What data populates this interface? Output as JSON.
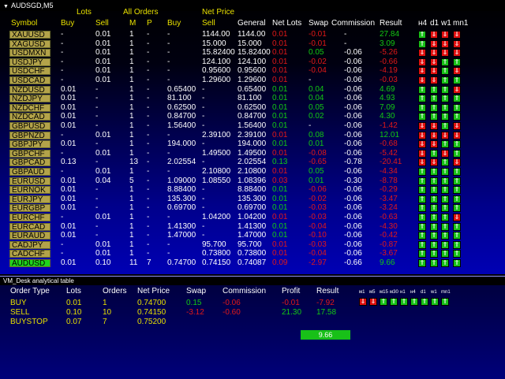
{
  "window": {
    "title": "AUDSGD,M5"
  },
  "table": {
    "header_groups": {
      "lots": "Lots",
      "all_orders": "All Orders",
      "net_price": "Net Price"
    },
    "columns": {
      "symbol": "Symbol",
      "buy": "Buy",
      "sell": "Sell",
      "m": "M",
      "p": "P",
      "np_buy": "Buy",
      "np_sell": "Sell",
      "general": "General",
      "net_lots": "Net Lots",
      "swap": "Swap",
      "commission": "Commission",
      "result": "Result",
      "h4": "н4",
      "d1": "d1",
      "w1": "w1",
      "mn1": "mn1"
    },
    "rows": [
      {
        "symbol": "XAUUSD",
        "buy": "-",
        "sell": "0.01",
        "m": "1",
        "p": "-",
        "np_buy": "-",
        "np_sell": "1144.00",
        "general": "1144.00",
        "net_lots": "0.01",
        "net_lots_color": "red",
        "swap": "-0.01",
        "swap_color": "red",
        "commission": "-",
        "result": "27.84",
        "result_color": "green",
        "tf": [
          "up",
          "dn",
          "dn",
          "dn"
        ]
      },
      {
        "symbol": "XAGUSD",
        "buy": "-",
        "sell": "0.01",
        "m": "1",
        "p": "-",
        "np_buy": "-",
        "np_sell": "15.000",
        "general": "15.000",
        "net_lots": "0.01",
        "net_lots_color": "red",
        "swap": "-0.01",
        "swap_color": "red",
        "commission": "-",
        "result": "3.09",
        "result_color": "green",
        "tf": [
          "up",
          "dn",
          "dn",
          "dn"
        ]
      },
      {
        "symbol": "USDMXN",
        "buy": "-",
        "sell": "0.01",
        "m": "1",
        "p": "-",
        "np_buy": "-",
        "np_sell": "15.82400",
        "general": "15.82400",
        "net_lots": "0.01",
        "net_lots_color": "red",
        "swap": "0.05",
        "swap_color": "green",
        "commission": "-0.06",
        "result": "-5.26",
        "result_color": "red",
        "tf": [
          "dn",
          "dn",
          "dn",
          "dn"
        ]
      },
      {
        "symbol": "USDJPY",
        "buy": "-",
        "sell": "0.01",
        "m": "1",
        "p": "-",
        "np_buy": "-",
        "np_sell": "124.100",
        "general": "124.100",
        "net_lots": "0.01",
        "net_lots_color": "red",
        "swap": "-0.02",
        "swap_color": "red",
        "commission": "-0.06",
        "result": "-0.66",
        "result_color": "red",
        "tf": [
          "dn",
          "dn",
          "up",
          "up"
        ]
      },
      {
        "symbol": "USDCHF",
        "buy": "-",
        "sell": "0.01",
        "m": "1",
        "p": "-",
        "np_buy": "-",
        "np_sell": "0.95600",
        "general": "0.95600",
        "net_lots": "0.01",
        "net_lots_color": "red",
        "swap": "-0.04",
        "swap_color": "red",
        "commission": "-0.06",
        "result": "-4.19",
        "result_color": "red",
        "tf": [
          "dn",
          "dn",
          "up",
          "dn"
        ]
      },
      {
        "symbol": "USDCAD",
        "buy": "-",
        "sell": "0.01",
        "m": "1",
        "p": "-",
        "np_buy": "-",
        "np_sell": "1.29600",
        "general": "1.29600",
        "net_lots": "0.01",
        "net_lots_color": "red",
        "swap": "-",
        "swap_color": "white",
        "commission": "-0.06",
        "result": "-0.03",
        "result_color": "red",
        "tf": [
          "dn",
          "dn",
          "up",
          "up"
        ]
      },
      {
        "symbol": "NZDUSD",
        "buy": "0.01",
        "sell": "-",
        "m": "1",
        "p": "-",
        "np_buy": "0.65400",
        "np_sell": "-",
        "general": "0.65400",
        "net_lots": "0.01",
        "net_lots_color": "green",
        "swap": "0.04",
        "swap_color": "green",
        "commission": "-0.06",
        "result": "4.69",
        "result_color": "green",
        "tf": [
          "up",
          "up",
          "up",
          "dn"
        ]
      },
      {
        "symbol": "NZDJPY",
        "buy": "0.01",
        "sell": "-",
        "m": "1",
        "p": "-",
        "np_buy": "81.100",
        "np_sell": "-",
        "general": "81.100",
        "net_lots": "0.01",
        "net_lots_color": "green",
        "swap": "0.04",
        "swap_color": "green",
        "commission": "-0.06",
        "result": "4.93",
        "result_color": "green",
        "tf": [
          "up",
          "up",
          "up",
          "up"
        ]
      },
      {
        "symbol": "NZDCHF",
        "buy": "0.01",
        "sell": "-",
        "m": "1",
        "p": "-",
        "np_buy": "0.62500",
        "np_sell": "-",
        "general": "0.62500",
        "net_lots": "0.01",
        "net_lots_color": "green",
        "swap": "0.05",
        "swap_color": "green",
        "commission": "-0.06",
        "result": "7.09",
        "result_color": "green",
        "tf": [
          "up",
          "up",
          "up",
          "up"
        ]
      },
      {
        "symbol": "NZDCAD",
        "buy": "0.01",
        "sell": "-",
        "m": "1",
        "p": "-",
        "np_buy": "0.84700",
        "np_sell": "-",
        "general": "0.84700",
        "net_lots": "0.01",
        "net_lots_color": "green",
        "swap": "0.02",
        "swap_color": "green",
        "commission": "-0.06",
        "result": "4.30",
        "result_color": "green",
        "tf": [
          "up",
          "up",
          "up",
          "up"
        ]
      },
      {
        "symbol": "GBPUSD",
        "buy": "0.01",
        "sell": "-",
        "m": "1",
        "p": "-",
        "np_buy": "1.56400",
        "np_sell": "-",
        "general": "1.56400",
        "net_lots": "0.01",
        "net_lots_color": "green",
        "swap": "-",
        "swap_color": "white",
        "commission": "-0.06",
        "result": "-1.42",
        "result_color": "red",
        "tf": [
          "dn",
          "dn",
          "up",
          "dn"
        ]
      },
      {
        "symbol": "GBPNZD",
        "buy": "-",
        "sell": "0.01",
        "m": "1",
        "p": "-",
        "np_buy": "-",
        "np_sell": "2.39100",
        "general": "2.39100",
        "net_lots": "0.01",
        "net_lots_color": "red",
        "swap": "0.08",
        "swap_color": "green",
        "commission": "-0.06",
        "result": "12.01",
        "result_color": "green",
        "tf": [
          "dn",
          "dn",
          "dn",
          "dn"
        ]
      },
      {
        "symbol": "GBPJPY",
        "buy": "0.01",
        "sell": "-",
        "m": "1",
        "p": "-",
        "np_buy": "194.000",
        "np_sell": "-",
        "general": "194.000",
        "net_lots": "0.01",
        "net_lots_color": "green",
        "swap": "0.01",
        "swap_color": "green",
        "commission": "-0.06",
        "result": "-0.68",
        "result_color": "red",
        "tf": [
          "dn",
          "dn",
          "up",
          "up"
        ]
      },
      {
        "symbol": "GBPCHF",
        "buy": "-",
        "sell": "0.01",
        "m": "1",
        "p": "-",
        "np_buy": "-",
        "np_sell": "1.49500",
        "general": "1.49500",
        "net_lots": "0.01",
        "net_lots_color": "red",
        "swap": "-0.08",
        "swap_color": "red",
        "commission": "-0.06",
        "result": "-5.42",
        "result_color": "red",
        "tf": [
          "dn",
          "up",
          "dn",
          "up"
        ]
      },
      {
        "symbol": "GBPCAD",
        "buy": "0.13",
        "sell": "-",
        "m": "13",
        "p": "-",
        "np_buy": "2.02554",
        "np_sell": "-",
        "general": "2.02554",
        "net_lots": "0.13",
        "net_lots_color": "green",
        "swap": "-0.65",
        "swap_color": "red",
        "commission": "-0.78",
        "result": "-20.41",
        "result_color": "red",
        "tf": [
          "dn",
          "dn",
          "up",
          "dn"
        ]
      },
      {
        "symbol": "GBPAUD",
        "buy": "-",
        "sell": "0.01",
        "m": "1",
        "p": "-",
        "np_buy": "-",
        "np_sell": "2.10800",
        "general": "2.10800",
        "net_lots": "0.01",
        "net_lots_color": "red",
        "swap": "0.05",
        "swap_color": "green",
        "commission": "-0.06",
        "result": "-4.34",
        "result_color": "red",
        "tf": [
          "up",
          "up",
          "up",
          "up"
        ]
      },
      {
        "symbol": "EURUSD",
        "buy": "0.01",
        "sell": "0.04",
        "m": "5",
        "p": "-",
        "np_buy": "1.09000",
        "np_sell": "1.08550",
        "general": "1.08396",
        "net_lots": "0.03",
        "net_lots_color": "red",
        "swap": "0.01",
        "swap_color": "green",
        "commission": "-0.30",
        "result": "-8.78",
        "result_color": "red",
        "tf": [
          "up",
          "up",
          "up",
          "up"
        ]
      },
      {
        "symbol": "EURNOK",
        "buy": "0.01",
        "sell": "-",
        "m": "1",
        "p": "-",
        "np_buy": "8.88400",
        "np_sell": "-",
        "general": "8.88400",
        "net_lots": "0.01",
        "net_lots_color": "green",
        "swap": "-0.06",
        "swap_color": "red",
        "commission": "-0.06",
        "result": "-0.29",
        "result_color": "red",
        "tf": [
          "up",
          "up",
          "up",
          "up"
        ]
      },
      {
        "symbol": "EURJPY",
        "buy": "0.01",
        "sell": "-",
        "m": "1",
        "p": "-",
        "np_buy": "135.300",
        "np_sell": "-",
        "general": "135.300",
        "net_lots": "0.01",
        "net_lots_color": "green",
        "swap": "-0.02",
        "swap_color": "red",
        "commission": "-0.06",
        "result": "-3.47",
        "result_color": "red",
        "tf": [
          "up",
          "up",
          "up",
          "up"
        ]
      },
      {
        "symbol": "EURGBP",
        "buy": "0.01",
        "sell": "-",
        "m": "1",
        "p": "-",
        "np_buy": "0.69700",
        "np_sell": "-",
        "general": "0.69700",
        "net_lots": "0.01",
        "net_lots_color": "green",
        "swap": "-0.03",
        "swap_color": "red",
        "commission": "-0.06",
        "result": "-3.24",
        "result_color": "red",
        "tf": [
          "up",
          "up",
          "up",
          "up"
        ]
      },
      {
        "symbol": "EURCHF",
        "buy": "-",
        "sell": "0.01",
        "m": "1",
        "p": "-",
        "np_buy": "-",
        "np_sell": "1.04200",
        "general": "1.04200",
        "net_lots": "0.01",
        "net_lots_color": "red",
        "swap": "-0.03",
        "swap_color": "red",
        "commission": "-0.06",
        "result": "-0.63",
        "result_color": "red",
        "tf": [
          "up",
          "up",
          "up",
          "dn"
        ]
      },
      {
        "symbol": "EURCAD",
        "buy": "0.01",
        "sell": "-",
        "m": "1",
        "p": "-",
        "np_buy": "1.41300",
        "np_sell": "-",
        "general": "1.41300",
        "net_lots": "0.01",
        "net_lots_color": "green",
        "swap": "-0.04",
        "swap_color": "red",
        "commission": "-0.06",
        "result": "-4.30",
        "result_color": "red",
        "tf": [
          "up",
          "up",
          "up",
          "up"
        ]
      },
      {
        "symbol": "EURAUD",
        "buy": "0.01",
        "sell": "-",
        "m": "1",
        "p": "-",
        "np_buy": "1.47000",
        "np_sell": "-",
        "general": "1.47000",
        "net_lots": "0.01",
        "net_lots_color": "green",
        "swap": "-0.10",
        "swap_color": "red",
        "commission": "-0.06",
        "result": "-0.42",
        "result_color": "red",
        "tf": [
          "up",
          "up",
          "up",
          "up"
        ]
      },
      {
        "symbol": "CADJPY",
        "buy": "-",
        "sell": "0.01",
        "m": "1",
        "p": "-",
        "np_buy": "-",
        "np_sell": "95.700",
        "general": "95.700",
        "net_lots": "0.01",
        "net_lots_color": "red",
        "swap": "-0.03",
        "swap_color": "red",
        "commission": "-0.06",
        "result": "-0.87",
        "result_color": "red",
        "tf": [
          "up",
          "up",
          "up",
          "up"
        ]
      },
      {
        "symbol": "CADCHF",
        "buy": "-",
        "sell": "0.01",
        "m": "1",
        "p": "-",
        "np_buy": "-",
        "np_sell": "0.73800",
        "general": "0.73800",
        "net_lots": "0.01",
        "net_lots_color": "red",
        "swap": "-0.04",
        "swap_color": "red",
        "commission": "-0.06",
        "result": "-3.67",
        "result_color": "red",
        "tf": [
          "up",
          "up",
          "up",
          "up"
        ]
      },
      {
        "symbol": "AUDUSD",
        "buy": "0.01",
        "sell": "0.10",
        "m": "11",
        "p": "7",
        "np_buy": "0.74700",
        "np_sell": "0.74150",
        "general": "0.74087",
        "net_lots": "0.09",
        "net_lots_color": "red",
        "swap": "-2.97",
        "swap_color": "red",
        "commission": "-0.66",
        "result": "9.66",
        "result_color": "green",
        "tf": [
          "up",
          "up",
          "up",
          "up"
        ],
        "selected": true
      }
    ]
  },
  "panel": {
    "title": "VM_Desk analytical table",
    "headers": {
      "order_type": "Order Type",
      "lots": "Lots",
      "orders": "Orders",
      "net_price": "Net Price",
      "swap": "Swap",
      "commission": "Commission",
      "profit": "Profit",
      "result": "Result"
    },
    "rows": [
      {
        "order_type": "BUY",
        "lots": "0.01",
        "orders": "1",
        "net_price": "0.74700",
        "swap": "0.15",
        "swap_color": "green",
        "commission": "-0.06",
        "commission_color": "red",
        "profit": "-0.01",
        "profit_color": "red",
        "result": "-7.92",
        "result_color": "red"
      },
      {
        "order_type": "SELL",
        "lots": "0.10",
        "orders": "10",
        "net_price": "0.74150",
        "swap": "-3.12",
        "swap_color": "red",
        "commission": "-0.60",
        "commission_color": "red",
        "profit": "21.30",
        "profit_color": "green",
        "result": "17.58",
        "result_color": "green"
      },
      {
        "order_type": "BUYSTOP",
        "lots": "0.07",
        "orders": "7",
        "net_price": "0.75200",
        "swap": "",
        "commission": "",
        "profit": "",
        "result": ""
      }
    ],
    "tf_labels": [
      "м1",
      "м5",
      "м15",
      "м30",
      "н1",
      "н4",
      "d1",
      "w1",
      "mn1"
    ],
    "tf_states": [
      "dn",
      "dn",
      "up",
      "up",
      "up",
      "up",
      "up",
      "up",
      "up"
    ],
    "total_result": "9.66"
  },
  "colors": {
    "red": "#e21818",
    "green": "#13c913",
    "white": "#ffffff",
    "bar_green": "#18c018"
  }
}
